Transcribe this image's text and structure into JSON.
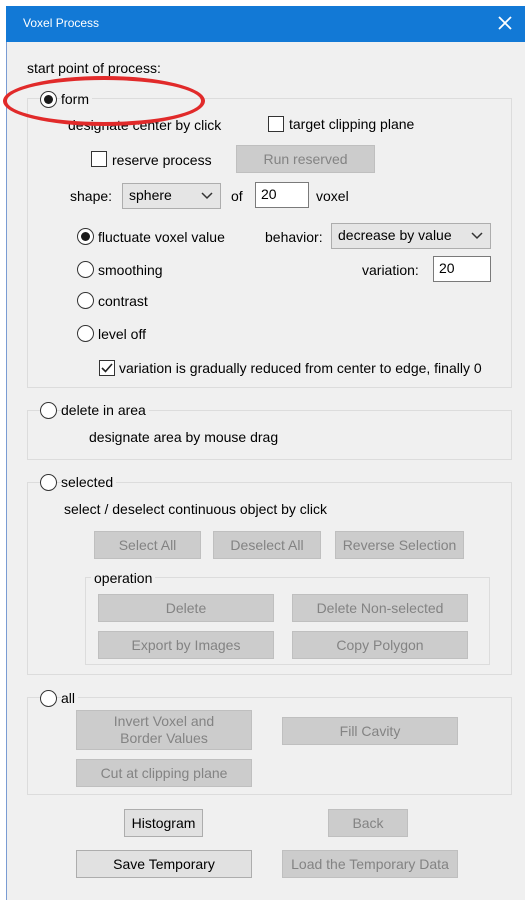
{
  "window": {
    "title": "Voxel Process"
  },
  "start_label": "start point of process:",
  "form": {
    "label": "form",
    "designate": "designate center by click",
    "target_clipping": "target clipping plane",
    "reserve_process": "reserve process",
    "run_reserved": "Run reserved",
    "shape_label": "shape:",
    "shape_value": "sphere",
    "of_label": "of",
    "size_value": "20",
    "voxel_label": "voxel",
    "fluctuate": "fluctuate voxel value",
    "behavior_label": "behavior:",
    "behavior_value": "decrease by value",
    "smoothing": "smoothing",
    "variation_label": "variation:",
    "variation_value": "20",
    "contrast": "contrast",
    "level_off": "level off",
    "gradual": "variation is gradually reduced from center to edge, finally 0"
  },
  "delete_area": {
    "label": "delete in area",
    "hint": "designate area by mouse drag"
  },
  "selected": {
    "label": "selected",
    "hint": "select / deselect continuous object by click",
    "select_all": "Select All",
    "deselect_all": "Deselect All",
    "reverse_selection": "Reverse Selection",
    "operation_label": "operation",
    "delete": "Delete",
    "delete_non_selected": "Delete Non-selected",
    "export_images": "Export by Images",
    "copy_polygon": "Copy Polygon"
  },
  "all": {
    "label": "all",
    "invert_line1": "Invert Voxel and",
    "invert_line2": "Border Values",
    "fill_cavity": "Fill Cavity",
    "cut_clipping": "Cut at clipping plane"
  },
  "bottom": {
    "histogram": "Histogram",
    "back": "Back",
    "save_temporary": "Save Temporary",
    "load_temporary": "Load the Temporary Data"
  },
  "state": {
    "process_mode": "form",
    "form_sub_mode": "fluctuate voxel value",
    "target_clipping_checked": false,
    "reserve_process_checked": false,
    "gradual_checked": true
  },
  "colors": {
    "titlebar": "#1279d6",
    "annotation": "#e12a2a"
  },
  "icons": {
    "close": "close-icon",
    "dropdown": "chevron-down-icon",
    "check": "checkmark-icon"
  }
}
